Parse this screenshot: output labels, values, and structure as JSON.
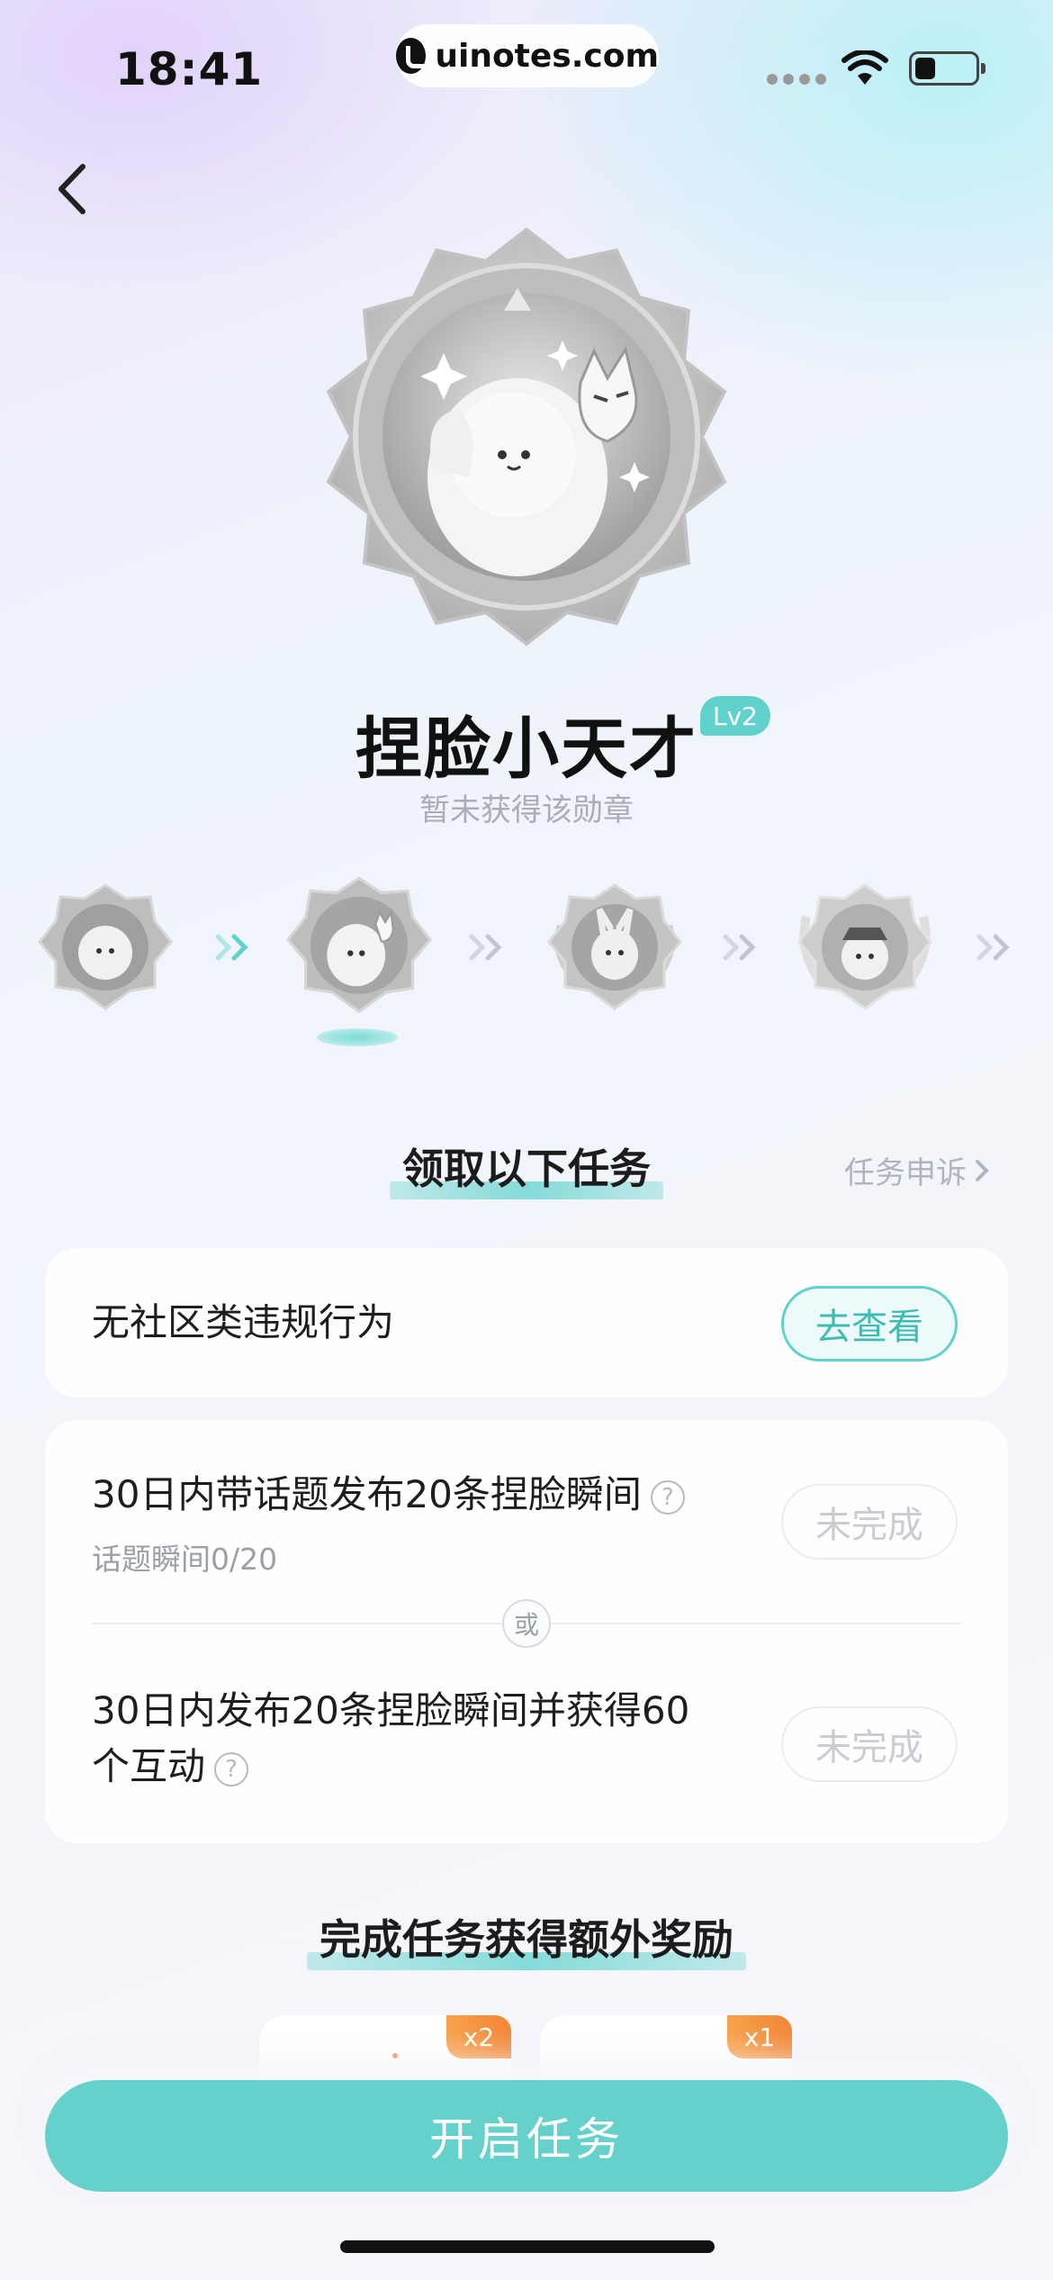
{
  "status_bar": {
    "time": "18:41",
    "url": "uinotes.com"
  },
  "badge": {
    "title": "捏脸小天才",
    "level": "Lv2",
    "status": "暂未获得该勋章",
    "levels_count": 4,
    "active_level_index": 1
  },
  "tasks_section": {
    "title": "领取以下任务",
    "appeal_link": "任务申诉"
  },
  "tasks": {
    "task1": {
      "text": "无社区类违规行为",
      "button": "去查看"
    },
    "task2": {
      "text": "30日内带话题发布20条捏脸瞬间",
      "progress": "话题瞬间0/20",
      "button": "未完成"
    },
    "or_label": "或",
    "task3": {
      "line1": "30日内发布20条捏脸瞬间并获得60",
      "line2": "个互动",
      "button": "未完成"
    }
  },
  "rewards_section": {
    "title": "完成任务获得额外奖励",
    "rewards": [
      {
        "tag": "x2"
      },
      {
        "tag": "x1"
      }
    ]
  },
  "start_button": "开启任务",
  "colors": {
    "accent": "#66d1cb",
    "reward_tag": "#f28534"
  }
}
